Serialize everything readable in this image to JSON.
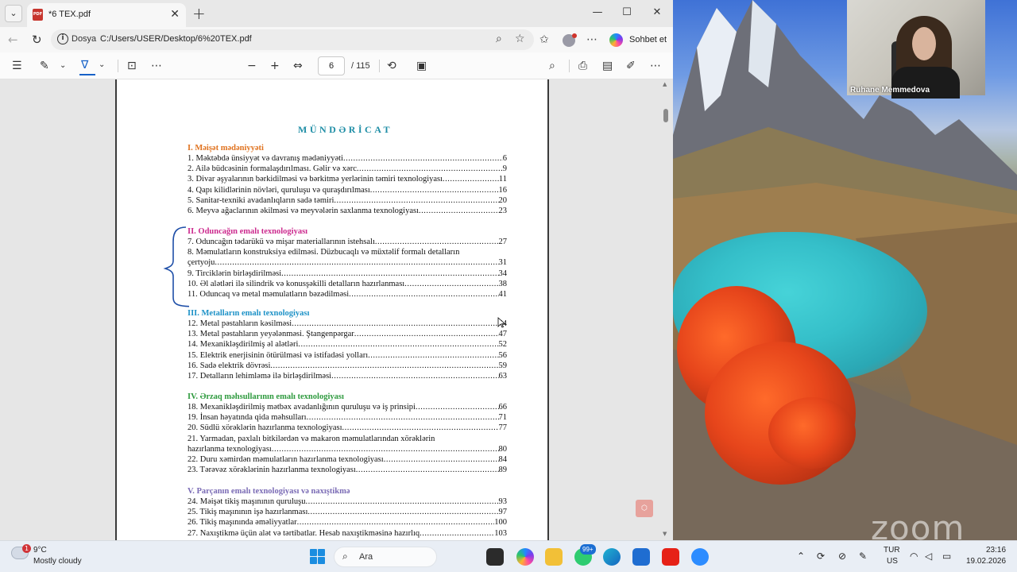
{
  "browser": {
    "tab_title": "*6 TEX.pdf",
    "pdf_badge": "PDF",
    "url_scheme": "Dosya",
    "url": "C:/Users/USER/Desktop/6%20TEX.pdf",
    "copilot_label": "Sohbet et"
  },
  "pdf_toolbar": {
    "page_current": "6",
    "page_total": "/ 115"
  },
  "document": {
    "title": "MÜNDƏRİCAT",
    "title_color": "#1f8ea6",
    "sections": [
      {
        "heading": "I.  Məişət mədəniyyəti",
        "color": "#e07320",
        "entries": [
          {
            "text": "1. Məktəbdə ünsiyyət və davranış mədəniyyəti",
            "page": "6"
          },
          {
            "text": "2. Ailə büdcəsinin formalaşdırılması. Gəlir və xərc",
            "page": "9"
          },
          {
            "text": "3. Divar əşyalarının bərkidilməsi və bərkitmə yerlərinin təmiri texnologiyası",
            "page": "11"
          },
          {
            "text": "4. Qapı kilidlərinin növləri, quruluşu və quraşdırılması",
            "page": "16"
          },
          {
            "text": "5. Sanitar-texniki avadanlıqların sadə təmiri",
            "page": "20"
          },
          {
            "text": "6. Meyvə ağaclarının əkilməsi və meyvələrin saxlanma texnologiyası",
            "page": "23"
          }
        ]
      },
      {
        "heading": "II. Oduncağın emalı texnologiyası",
        "color": "#cc2a8e",
        "entries": [
          {
            "text": "7. Oduncağın tədarükü və mişar materiallarının istehsalı",
            "page": "27"
          },
          {
            "lines": [
              "8. Məmulatların konstruksiya edilməsi. Düzbucaqlı və müxtəlif formalı detalların"
            ],
            "text": "çertyoju",
            "page": "31"
          },
          {
            "text": "9. Tirciklərin birləşdirilməsi",
            "page": "34"
          },
          {
            "text": "10. Əl alətləri ilə silindrik və konusşəkilli detalların hazırlanması",
            "page": "38"
          },
          {
            "text": "11. Oduncaq və metal məmulatların bəzədilməsi",
            "page": "41"
          }
        ]
      },
      {
        "heading": "III. Metalların emalı texnologiyası",
        "color": "#1e92c7",
        "entries": [
          {
            "text": "12. Metal pəstahların kəsilməsi",
            "page": "44"
          },
          {
            "text": "13. Metal pəstahların yeyələnməsi. Ştangenpərgar",
            "page": "47"
          },
          {
            "text": "14. Mexanikləşdirilmiş əl alətləri",
            "page": "52"
          },
          {
            "text": "15. Elektrik enerjisinin ötürülməsi və istifadəsi yolları",
            "page": "56"
          },
          {
            "text": "16. Sadə elektrik dövrəsi",
            "page": "59"
          },
          {
            "text": "17. Detalların lehimləmə ilə birləşdirilməsi",
            "page": "63"
          }
        ]
      },
      {
        "heading": "IV. Ərzaq məhsullarının emalı texnologiyası",
        "color": "#2e9a3e",
        "entries": [
          {
            "text": "18. Mexanikləşdirilmiş mətbəx avadanlığının quruluşu və iş prinsipi",
            "page": "66"
          },
          {
            "text": "19. İnsan həyatında qida məhsulları",
            "page": "71"
          },
          {
            "text": "20.  Südlü  xörəklərin  hazırlanma  texnologiyası",
            "page": "77"
          },
          {
            "lines": [
              "21. Yarmadan, paxlalı bitkilərdən və makaron məmulatlarından xörəklərin"
            ],
            "text": "hazırlanma   texnologiyası",
            "page": "80"
          },
          {
            "text": "22. Duru xəmirdən məmulatların hazırlanma   texnologiyası",
            "page": "84"
          },
          {
            "text": "23. Tərəvəz xörəklərinin hazırlanma texnologiyası",
            "page": "89"
          }
        ]
      },
      {
        "heading": "V.  Parçanın emalı texnologiyası və naxıştikmə",
        "color": "#7a6bb5",
        "entries": [
          {
            "text": "24. Məişət tikiş maşınının quruluşu",
            "page": "93"
          },
          {
            "text": "25. Tikiş maşınının işə hazırlanması",
            "page": "97"
          },
          {
            "text": "26. Tikiş maşınında əməliyyatlar",
            "page": "100"
          },
          {
            "text": "27. Naxıştikmə üçün alət və tərtibatlar. Hesab naxıştikməsinə hazırlıq",
            "page": "103"
          }
        ]
      }
    ]
  },
  "video": {
    "participant_name": "Ruhane Memmedova",
    "watermark": "zoom"
  },
  "taskbar": {
    "weather_temp": "9°C",
    "weather_condition": "Mostly cloudy",
    "weather_badge": "1",
    "search_label": "Ara",
    "whatsapp_badge": "99+",
    "lang_code": "TUR",
    "lang_region": "US",
    "time": "23:16",
    "date": "19.02.2026"
  }
}
